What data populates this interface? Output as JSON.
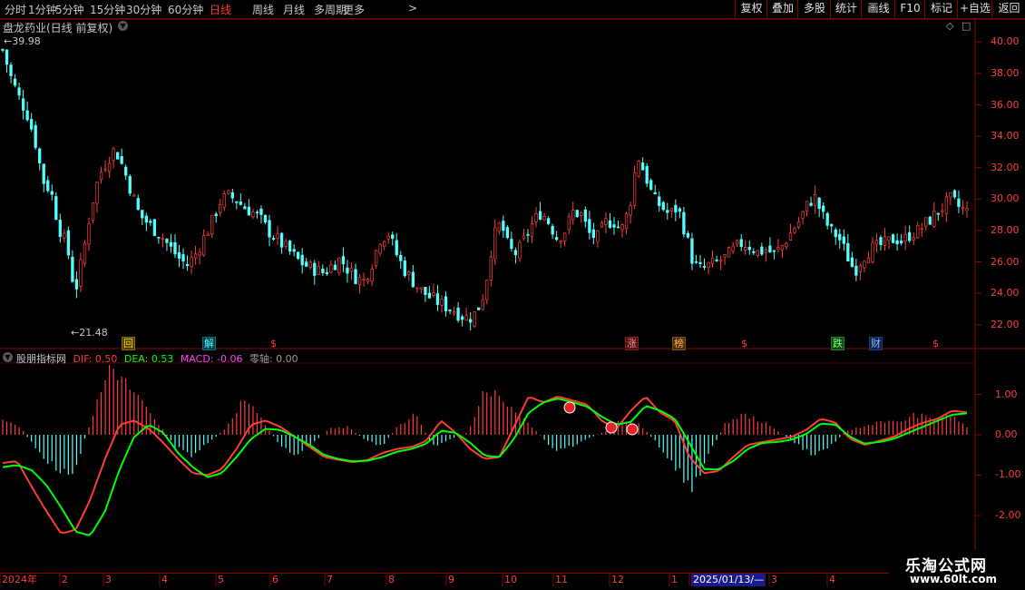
{
  "toolbar": {
    "timeframes": [
      "分时",
      "1分钟",
      "5分钟",
      "15分钟",
      "30分钟",
      "60分钟",
      "日线",
      "周线",
      "月线",
      "多周期",
      "更多"
    ],
    "active_timeframe": "日线",
    "right_buttons": [
      "复权",
      "叠加",
      "多股",
      "统计",
      "画线",
      "F10",
      "标记",
      "+自选",
      "返回"
    ]
  },
  "stock": {
    "title": "盘龙药业(日线 前复权)",
    "high_mark": "39.98",
    "low_mark": "21.48"
  },
  "events": [
    "回",
    "解",
    "$",
    "涨",
    "榜",
    "$",
    "跌",
    "财",
    "$"
  ],
  "indicator": {
    "name": "股朋指标网",
    "dif_label": "DIF: 0.50",
    "dea_label": "DEA: 0.53",
    "macd_label": "MACD: -0.06",
    "zero_label": "零轴: 0.00"
  },
  "price_axis": [
    "40.00",
    "38.00",
    "36.00",
    "34.00",
    "32.00",
    "30.00",
    "28.00",
    "26.00",
    "24.00",
    "22.00"
  ],
  "indicator_axis": [
    "1.00",
    "0.00",
    "-1.00",
    "-2.00"
  ],
  "date_axis": [
    "2024年",
    "2",
    "3",
    "4",
    "5",
    "6",
    "7",
    "8",
    "9",
    "10",
    "11",
    "12",
    "1",
    "2025/01/13/—",
    "3",
    "4"
  ],
  "watermark": {
    "line1": "乐淘公式网",
    "line2": "www.60lt.com"
  },
  "colors": {
    "up": "#ff3c3c",
    "down": "#54ffff",
    "dea": "#00ff00",
    "macd_label": "#ff40ff",
    "grid": "#8b0000"
  },
  "chart_data": [
    {
      "type": "candlestick",
      "title": "盘龙药业(日线 前复权)",
      "ylim": [
        21.0,
        41.0
      ],
      "price_high": 39.98,
      "price_low": 21.48,
      "close_path": [
        39.5,
        37.8,
        36.5,
        35.5,
        33.8,
        31.2,
        30.5,
        28.2,
        27.0,
        24.0,
        26.5,
        29.5,
        31.5,
        32.5,
        33.2,
        32.0,
        30.5,
        29.0,
        28.5,
        28.0,
        27.5,
        26.8,
        26.2,
        25.8,
        26.5,
        27.5,
        28.5,
        29.8,
        30.2,
        30.0,
        29.5,
        29.2,
        28.8,
        28.0,
        27.5,
        27.0,
        26.5,
        26.0,
        25.7,
        25.5,
        25.3,
        25.8,
        26.2,
        25.5,
        25.0,
        24.8,
        26.0,
        27.5,
        27.8,
        26.5,
        25.5,
        24.8,
        24.2,
        23.8,
        23.5,
        23.2,
        23.0,
        22.6,
        22.4,
        22.8,
        24.2,
        27.5,
        28.5,
        26.8,
        26.5,
        27.5,
        28.5,
        29.2,
        28.5,
        27.5,
        28.0,
        29.2,
        29.0,
        27.8,
        27.5,
        28.5,
        28.6,
        28.0,
        29.5,
        32.8,
        31.5,
        30.0,
        29.5,
        29.0,
        29.5,
        27.8,
        25.8,
        25.5,
        25.8,
        26.0,
        26.3,
        26.8,
        27.2,
        27.0,
        26.6,
        26.8,
        26.5,
        27.0,
        27.8,
        28.5,
        29.5,
        30.2,
        29.0,
        28.0,
        27.6,
        26.5,
        25.4,
        26.3,
        26.8,
        27.0,
        27.2,
        27.5,
        27.3,
        27.8,
        28.0,
        28.5,
        29.0,
        29.5,
        30.0,
        29.5,
        29.2
      ],
      "xlabel": "",
      "ylabel": ""
    },
    {
      "type": "line",
      "title": "股朋指标网",
      "ylim": [
        -2.6,
        2.1
      ],
      "series": [
        {
          "name": "DIF",
          "values": [
            -0.7,
            -0.65,
            -1.3,
            -1.9,
            -2.45,
            -2.35,
            -1.6,
            -0.6,
            0.25,
            0.35,
            0.15,
            -0.2,
            -0.6,
            -0.95,
            -1.0,
            -0.85,
            -0.35,
            0.25,
            0.35,
            0.2,
            -0.05,
            -0.3,
            -0.55,
            -0.62,
            -0.68,
            -0.62,
            -0.45,
            -0.35,
            -0.3,
            -0.15,
            0.35,
            0.05,
            -0.35,
            -0.6,
            -0.55,
            0.2,
            0.95,
            0.8,
            0.95,
            0.85,
            0.75,
            0.35,
            0.15,
            0.6,
            0.95,
            0.55,
            0.35,
            -0.55,
            -0.95,
            -0.9,
            -0.55,
            -0.25,
            -0.18,
            -0.12,
            -0.05,
            0.12,
            0.4,
            0.3,
            -0.1,
            -0.25,
            -0.15,
            -0.05,
            0.15,
            0.3,
            0.4,
            0.6,
            0.55
          ]
        },
        {
          "name": "DEA",
          "values": [
            -0.8,
            -0.75,
            -0.88,
            -1.25,
            -1.8,
            -2.4,
            -2.5,
            -1.9,
            -0.85,
            -0.05,
            0.25,
            0.05,
            -0.45,
            -0.8,
            -1.05,
            -0.95,
            -0.55,
            -0.1,
            0.15,
            0.12,
            -0.05,
            -0.25,
            -0.5,
            -0.6,
            -0.66,
            -0.64,
            -0.55,
            -0.42,
            -0.35,
            -0.22,
            0.1,
            0.05,
            -0.2,
            -0.52,
            -0.55,
            -0.1,
            0.55,
            0.8,
            0.9,
            0.8,
            0.7,
            0.45,
            0.25,
            0.32,
            0.72,
            0.6,
            0.4,
            -0.2,
            -0.85,
            -0.86,
            -0.65,
            -0.35,
            -0.2,
            -0.18,
            -0.12,
            0.02,
            0.28,
            0.25,
            -0.05,
            -0.22,
            -0.18,
            -0.1,
            0.05,
            0.2,
            0.35,
            0.5,
            0.53
          ]
        },
        {
          "name": "MACD",
          "values": [
            0.35,
            0.2,
            -0.4,
            -0.8,
            -1.1,
            0.2,
            1.6,
            1.3,
            0.9,
            0.3,
            -0.3,
            -0.5,
            -0.2,
            0.2,
            0.9,
            0.4,
            -0.2,
            -0.5,
            -0.2,
            0.15,
            0.2,
            -0.1,
            -0.3,
            0.25,
            0.5,
            -0.3,
            -0.1,
            0.05,
            1.2,
            0.9,
            0.5,
            0.1,
            -0.4,
            -0.3,
            -0.1,
            0.1,
            0.4,
            0.25,
            -0.2,
            -0.8,
            -1.3,
            -0.5,
            0.3,
            0.5,
            0.35,
            0.1,
            -0.2,
            -0.5,
            -0.3,
            0.1,
            0.2,
            0.35,
            0.3,
            0.5,
            0.4,
            0.5,
            0.2
          ]
        }
      ],
      "zero_axis": 0.0,
      "xlabel": "",
      "ylabel": ""
    }
  ]
}
